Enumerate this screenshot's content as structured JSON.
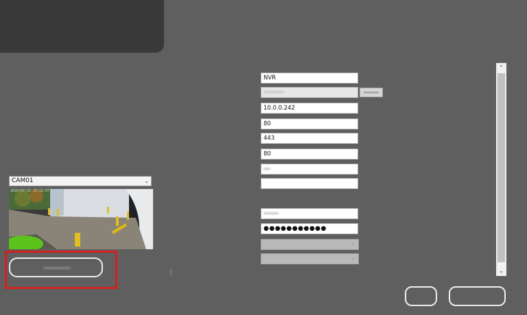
{
  "camera": {
    "selected": "CAM01",
    "dropdown_icon": "chevron-down-icon",
    "timestamp": "2020/07/16 15:22:07"
  },
  "form": {
    "name_value": "NVR",
    "ip_value": "10.0.0.242",
    "http_port_value": "80",
    "https_port_value": "443",
    "rtsp_port_value": "80",
    "password_value": "●●●●●●●●●●●"
  },
  "scrollbar": {
    "up_icon": "chevron-up-icon",
    "down_icon": "chevron-down-icon"
  },
  "colors": {
    "background": "#5f5f5f",
    "top_panel": "#393939",
    "highlight": "#d41f1f",
    "button_border": "#eeeeee"
  }
}
